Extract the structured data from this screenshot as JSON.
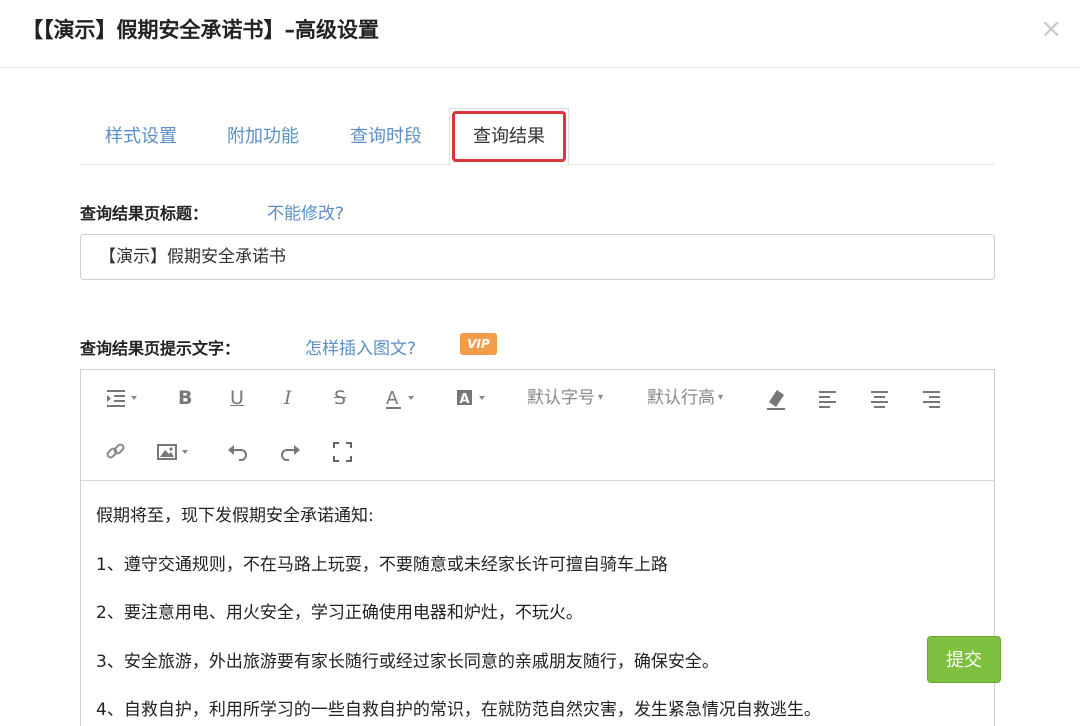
{
  "modal": {
    "title": "【【演示】假期安全承诺书】–高级设置",
    "close_glyph": "×"
  },
  "tabs": [
    {
      "label": "样式设置",
      "active": false
    },
    {
      "label": "附加功能",
      "active": false
    },
    {
      "label": "查询时段",
      "active": false
    },
    {
      "label": "查询结果",
      "active": true
    }
  ],
  "result_title": {
    "label": "查询结果页标题：",
    "help": "不能修改?",
    "value": "【演示】假期安全承诺书"
  },
  "result_tip": {
    "label": "查询结果页提示文字：",
    "help": "怎样插入图文?",
    "badge": "VIP"
  },
  "toolbar": {
    "font_size": "默认字号",
    "line_height": "默认行高",
    "icons": [
      "indent-icon",
      "bold-icon",
      "underline-icon",
      "italic-icon",
      "strikethrough-icon",
      "font-color-icon",
      "background-color-icon",
      "eraser-icon",
      "align-left-icon",
      "align-center-icon",
      "align-right-icon",
      "link-icon",
      "image-icon",
      "undo-icon",
      "redo-icon",
      "fullscreen-icon"
    ]
  },
  "editor": {
    "paragraphs": [
      "假期将至，现下发假期安全承诺通知:",
      "1、遵守交通规则，不在马路上玩耍，不要随意或未经家长许可擅自骑车上路",
      "2、要注意用电、用火安全，学习正确使用电器和炉灶，不玩火。",
      "3、安全旅游，外出旅游要有家长随行或经过家长同意的亲戚朋友随行，确保安全。",
      "4、自救自护，利用所学习的一些自救自护的常识，在就防范自然灾害，发生紧急情况自救逃生。"
    ]
  },
  "submit_label": "提交",
  "colors": {
    "link": "#5b8fc6",
    "highlight": "#d9363e",
    "vip": "#f39c4a",
    "submit": "#7dbf3e"
  }
}
